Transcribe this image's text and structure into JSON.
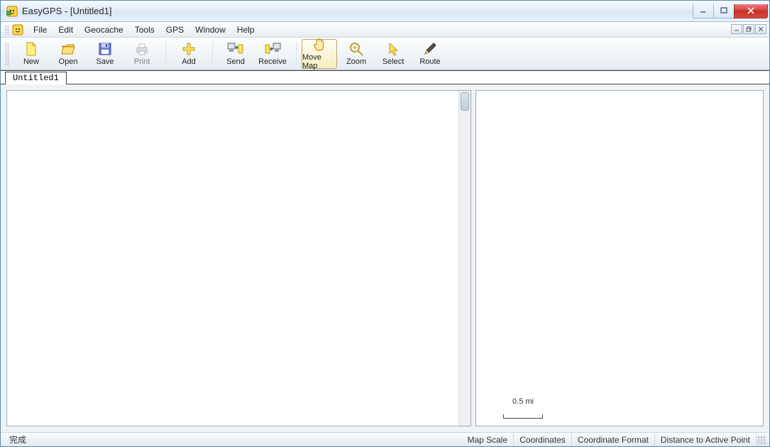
{
  "window": {
    "title": "EasyGPS - [Untitled1]"
  },
  "menu": {
    "items": [
      "File",
      "Edit",
      "Geocache",
      "Tools",
      "GPS",
      "Window",
      "Help"
    ]
  },
  "toolbar": {
    "buttons": [
      {
        "id": "new",
        "label": "New"
      },
      {
        "id": "open",
        "label": "Open"
      },
      {
        "id": "save",
        "label": "Save"
      },
      {
        "id": "print",
        "label": "Print",
        "disabled": true
      },
      {
        "id": "add",
        "label": "Add"
      },
      {
        "id": "send",
        "label": "Send"
      },
      {
        "id": "receive",
        "label": "Receive"
      },
      {
        "id": "movemap",
        "label": "Move Map",
        "active": true
      },
      {
        "id": "zoom",
        "label": "Zoom"
      },
      {
        "id": "select",
        "label": "Select"
      },
      {
        "id": "route",
        "label": "Route"
      }
    ]
  },
  "doc_tabs": [
    "Untitled1"
  ],
  "map": {
    "scale_label": "0.5 mi"
  },
  "statusbar": {
    "left": "完成",
    "cells": [
      "Map Scale",
      "Coordinates",
      "Coordinate Format",
      "Distance to Active Point"
    ]
  }
}
